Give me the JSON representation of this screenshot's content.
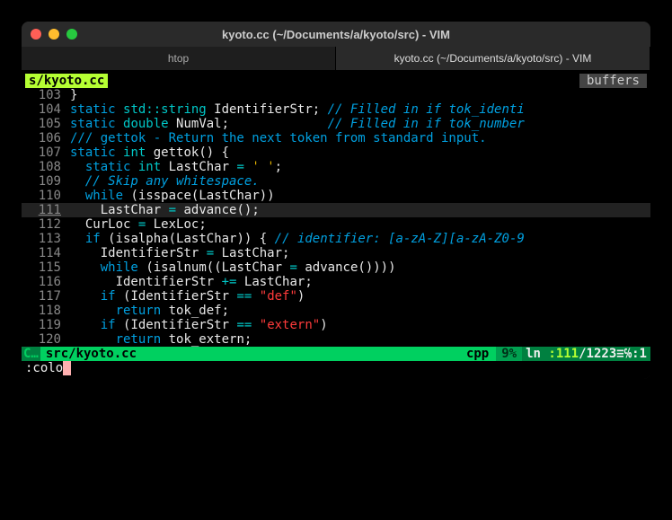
{
  "window": {
    "title": "kyoto.cc (~/Documents/a/kyoto/src) - VIM"
  },
  "tabs": [
    {
      "label": "htop",
      "active": false
    },
    {
      "label": "kyoto.cc (~/Documents/a/kyoto/src) - VIM",
      "active": true
    }
  ],
  "bufferline": {
    "name": "s/kyoto.cc",
    "label": "buffers"
  },
  "lines": [
    {
      "num": "103",
      "tokens": [
        [
          "pn",
          "}"
        ]
      ]
    },
    {
      "num": "104",
      "tokens": [
        [
          "kw",
          "static"
        ],
        [
          "pl",
          " "
        ],
        [
          "type",
          "std::string"
        ],
        [
          "pl",
          " "
        ],
        [
          "id",
          "IdentifierStr"
        ],
        [
          "pn",
          ";"
        ],
        [
          "pl",
          " "
        ],
        [
          "cm",
          "// Filled in if tok_identi"
        ]
      ]
    },
    {
      "num": "105",
      "tokens": [
        [
          "kw",
          "static"
        ],
        [
          "pl",
          " "
        ],
        [
          "type",
          "double"
        ],
        [
          "pl",
          " "
        ],
        [
          "id",
          "NumVal"
        ],
        [
          "pn",
          ";"
        ],
        [
          "pl",
          "             "
        ],
        [
          "cm",
          "// Filled in if tok_number"
        ]
      ]
    },
    {
      "num": "106",
      "tokens": [
        [
          "doc",
          "/// gettok - Return the next token from standard input."
        ]
      ]
    },
    {
      "num": "107",
      "tokens": [
        [
          "kw",
          "static"
        ],
        [
          "pl",
          " "
        ],
        [
          "type",
          "int"
        ],
        [
          "pl",
          " "
        ],
        [
          "fn",
          "gettok"
        ],
        [
          "pn",
          "()"
        ],
        [
          "pl",
          " "
        ],
        [
          "pn",
          "{"
        ]
      ]
    },
    {
      "num": "108",
      "tokens": [
        [
          "pl",
          "  "
        ],
        [
          "kw",
          "static"
        ],
        [
          "pl",
          " "
        ],
        [
          "type",
          "int"
        ],
        [
          "pl",
          " "
        ],
        [
          "id",
          "LastChar"
        ],
        [
          "pl",
          " "
        ],
        [
          "op",
          "="
        ],
        [
          "pl",
          " "
        ],
        [
          "ch",
          "' '"
        ],
        [
          "pn",
          ";"
        ]
      ]
    },
    {
      "num": "109",
      "tokens": [
        [
          "pl",
          "  "
        ],
        [
          "cm",
          "// Skip any whitespace."
        ]
      ]
    },
    {
      "num": "110",
      "tokens": [
        [
          "pl",
          "  "
        ],
        [
          "kw",
          "while"
        ],
        [
          "pl",
          " "
        ],
        [
          "pn",
          "("
        ],
        [
          "fn",
          "isspace"
        ],
        [
          "pn",
          "("
        ],
        [
          "id",
          "LastChar"
        ],
        [
          "pn",
          "))"
        ]
      ]
    },
    {
      "num": "111",
      "cursor": true,
      "tokens": [
        [
          "pl",
          "    "
        ],
        [
          "id",
          "LastChar"
        ],
        [
          "pl",
          " "
        ],
        [
          "op",
          "="
        ],
        [
          "pl",
          " "
        ],
        [
          "fn",
          "advance"
        ],
        [
          "pn",
          "();"
        ]
      ]
    },
    {
      "num": "112",
      "tokens": [
        [
          "pl",
          "  "
        ],
        [
          "id",
          "CurLoc"
        ],
        [
          "pl",
          " "
        ],
        [
          "op",
          "="
        ],
        [
          "pl",
          " "
        ],
        [
          "id",
          "LexLoc"
        ],
        [
          "pn",
          ";"
        ]
      ]
    },
    {
      "num": "113",
      "tokens": [
        [
          "pl",
          "  "
        ],
        [
          "kw",
          "if"
        ],
        [
          "pl",
          " "
        ],
        [
          "pn",
          "("
        ],
        [
          "fn",
          "isalpha"
        ],
        [
          "pn",
          "("
        ],
        [
          "id",
          "LastChar"
        ],
        [
          "pn",
          "))"
        ],
        [
          "pl",
          " "
        ],
        [
          "pn",
          "{"
        ],
        [
          "pl",
          " "
        ],
        [
          "cm",
          "// identifier: [a-zA-Z][a-zA-Z0-9"
        ]
      ]
    },
    {
      "num": "114",
      "tokens": [
        [
          "pl",
          "    "
        ],
        [
          "id",
          "IdentifierStr"
        ],
        [
          "pl",
          " "
        ],
        [
          "op",
          "="
        ],
        [
          "pl",
          " "
        ],
        [
          "id",
          "LastChar"
        ],
        [
          "pn",
          ";"
        ]
      ]
    },
    {
      "num": "115",
      "tokens": [
        [
          "pl",
          "    "
        ],
        [
          "kw",
          "while"
        ],
        [
          "pl",
          " "
        ],
        [
          "pn",
          "("
        ],
        [
          "fn",
          "isalnum"
        ],
        [
          "pn",
          "(("
        ],
        [
          "id",
          "LastChar"
        ],
        [
          "pl",
          " "
        ],
        [
          "op",
          "="
        ],
        [
          "pl",
          " "
        ],
        [
          "fn",
          "advance"
        ],
        [
          "pn",
          "())))"
        ]
      ]
    },
    {
      "num": "116",
      "tokens": [
        [
          "pl",
          "      "
        ],
        [
          "id",
          "IdentifierStr"
        ],
        [
          "pl",
          " "
        ],
        [
          "op",
          "+="
        ],
        [
          "pl",
          " "
        ],
        [
          "id",
          "LastChar"
        ],
        [
          "pn",
          ";"
        ]
      ]
    },
    {
      "num": "117",
      "tokens": [
        [
          "pl",
          "    "
        ],
        [
          "kw",
          "if"
        ],
        [
          "pl",
          " "
        ],
        [
          "pn",
          "("
        ],
        [
          "id",
          "IdentifierStr"
        ],
        [
          "pl",
          " "
        ],
        [
          "op",
          "=="
        ],
        [
          "pl",
          " "
        ],
        [
          "str",
          "\"def\""
        ],
        [
          "pn",
          ")"
        ]
      ]
    },
    {
      "num": "118",
      "tokens": [
        [
          "pl",
          "      "
        ],
        [
          "kw",
          "return"
        ],
        [
          "pl",
          " "
        ],
        [
          "id",
          "tok_def"
        ],
        [
          "pn",
          ";"
        ]
      ]
    },
    {
      "num": "119",
      "tokens": [
        [
          "pl",
          "    "
        ],
        [
          "kw",
          "if"
        ],
        [
          "pl",
          " "
        ],
        [
          "pn",
          "("
        ],
        [
          "id",
          "IdentifierStr"
        ],
        [
          "pl",
          " "
        ],
        [
          "op",
          "=="
        ],
        [
          "pl",
          " "
        ],
        [
          "str",
          "\"extern\""
        ],
        [
          "pn",
          ")"
        ]
      ]
    },
    {
      "num": "120",
      "tokens": [
        [
          "pl",
          "      "
        ],
        [
          "kw",
          "return"
        ],
        [
          "pl",
          " "
        ],
        [
          "id",
          "tok_extern"
        ],
        [
          "pn",
          ";"
        ]
      ]
    }
  ],
  "status": {
    "mode": "C…",
    "file": "src/kyoto.cc",
    "filetype": "cpp",
    "percent": "9%",
    "pos_prefix": "ln ",
    "line": ":111",
    "total": "/1223",
    "col_sep": "≡",
    "col": "℅:1"
  },
  "cmdline": ":colo"
}
